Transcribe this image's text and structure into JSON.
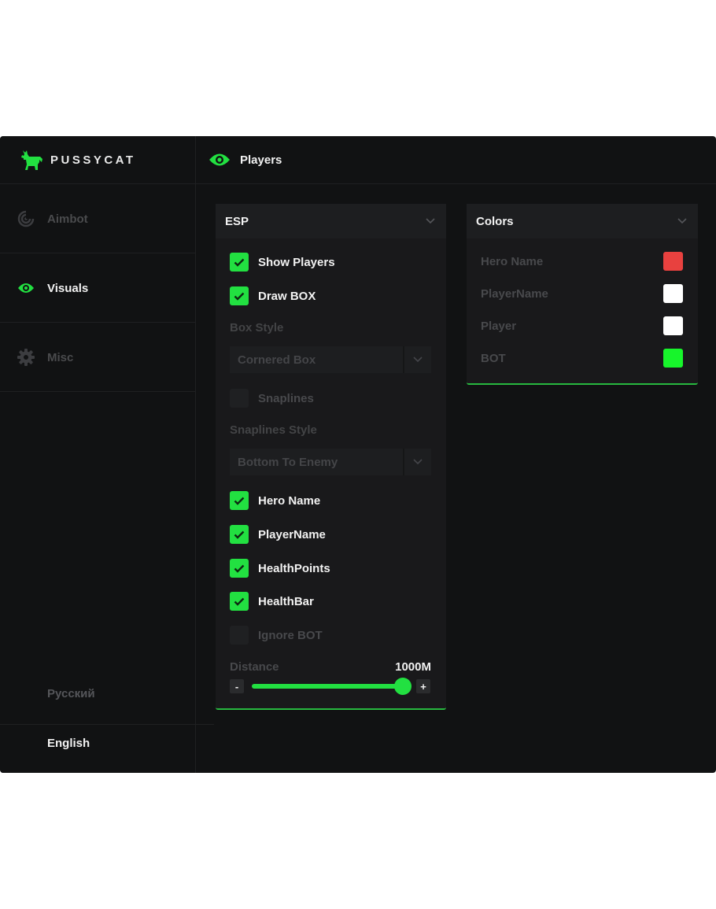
{
  "app": {
    "name": "PUSSYCAT"
  },
  "sidebar": {
    "items": [
      {
        "label": "Aimbot",
        "icon": "aimbot-icon",
        "active": false
      },
      {
        "label": "Visuals",
        "icon": "eye-icon",
        "active": true
      },
      {
        "label": "Misc",
        "icon": "gear-icon",
        "active": false
      }
    ],
    "languages": [
      {
        "label": "Русский",
        "active": false
      },
      {
        "label": "English",
        "active": true
      }
    ]
  },
  "header": {
    "title": "Players",
    "icon": "eye-icon"
  },
  "esp": {
    "title": "ESP",
    "show_players": {
      "label": "Show Players",
      "checked": true
    },
    "draw_box": {
      "label": "Draw BOX",
      "checked": true
    },
    "box_style": {
      "label": "Box Style",
      "value": "Cornered Box"
    },
    "snaplines": {
      "label": "Snaplines",
      "checked": false
    },
    "snaplines_style": {
      "label": "Snaplines Style",
      "value": "Bottom To Enemy"
    },
    "hero_name": {
      "label": "Hero Name",
      "checked": true
    },
    "player_name": {
      "label": "PlayerName",
      "checked": true
    },
    "health_points": {
      "label": "HealthPoints",
      "checked": true
    },
    "health_bar": {
      "label": "HealthBar",
      "checked": true
    },
    "ignore_bot": {
      "label": "Ignore BOT",
      "checked": false
    },
    "distance": {
      "label": "Distance",
      "value": "1000M",
      "fraction": 1.0,
      "minus": "-",
      "plus": "+"
    }
  },
  "colors": {
    "title": "Colors",
    "items": [
      {
        "label": "Hero Name",
        "color": "#e8413f"
      },
      {
        "label": "PlayerName",
        "color": "#ffffff"
      },
      {
        "label": "Player",
        "color": "#ffffff"
      },
      {
        "label": "BOT",
        "color": "#17f52b"
      }
    ]
  },
  "theme": {
    "accent": "#22e041",
    "background": "#111213",
    "panel": "#19191b"
  }
}
